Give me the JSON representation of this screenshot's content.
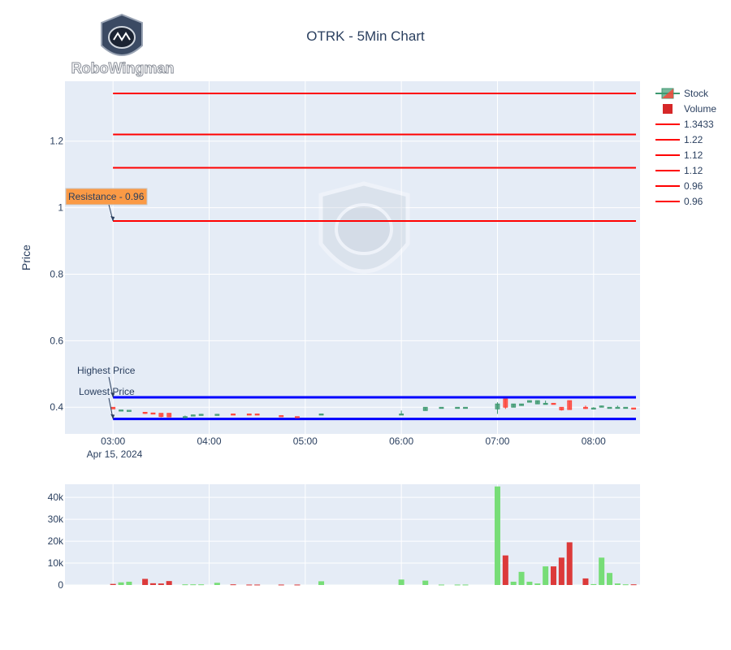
{
  "brand": {
    "logo_text": "RoboWingman"
  },
  "chart_data": {
    "type": "candlestick",
    "title": "OTRK - 5Min Chart",
    "price_axis": {
      "label": "Price",
      "ylim": [
        0.32,
        1.38
      ],
      "ticks": [
        0.4,
        0.6,
        0.8,
        1,
        1.2
      ],
      "tick_labels": [
        "0.4",
        "0.6",
        "0.8",
        "1",
        "1.2"
      ],
      "grid": true
    },
    "time_axis": {
      "start": "2024-04-15 02:30",
      "end": "2024-04-15 08:29",
      "ticks": [
        "03:00",
        "04:00",
        "05:00",
        "06:00",
        "07:00",
        "08:00"
      ],
      "tick_labels": [
        "03:00",
        "04:00",
        "05:00",
        "06:00",
        "07:00",
        "08:00"
      ],
      "date_label": "Apr 15, 2024"
    },
    "volume_axis": {
      "ylim": [
        0,
        46000
      ],
      "ticks": [
        0,
        10000,
        20000,
        30000,
        40000
      ],
      "tick_labels": [
        "0",
        "10k",
        "20k",
        "30k",
        "40k"
      ]
    },
    "horizontal_lines": [
      {
        "name": "1.3433",
        "value": 1.3433,
        "color": "#ff0000"
      },
      {
        "name": "1.22",
        "value": 1.22,
        "color": "#ff0000"
      },
      {
        "name": "1.12",
        "value": 1.12,
        "color": "#ff0000"
      },
      {
        "name": "1.12",
        "value": 1.12,
        "color": "#ff0000"
      },
      {
        "name": "0.96",
        "value": 0.96,
        "color": "#ff0000"
      },
      {
        "name": "0.96",
        "value": 0.96,
        "color": "#ff0000"
      }
    ],
    "level_lines": [
      {
        "value": 0.43,
        "color": "#0000ff"
      },
      {
        "value": 0.365,
        "color": "#0000ff"
      }
    ],
    "annotations": [
      {
        "text": "Resistance - 0.96",
        "time": "03:00",
        "value": 0.96,
        "boxed": true
      },
      {
        "text": "Highest Price",
        "time": "03:00",
        "value": 0.43
      },
      {
        "text": "Lowest Price",
        "time": "03:00",
        "value": 0.365
      }
    ],
    "legend": [
      {
        "name": "Stock",
        "kind": "candle"
      },
      {
        "name": "Volume",
        "kind": "bar",
        "color": "#d62728"
      },
      {
        "name": "1.3433",
        "kind": "line",
        "color": "#ff0000"
      },
      {
        "name": "1.22",
        "kind": "line",
        "color": "#ff0000"
      },
      {
        "name": "1.12",
        "kind": "line",
        "color": "#ff0000"
      },
      {
        "name": "1.12",
        "kind": "line",
        "color": "#ff0000"
      },
      {
        "name": "0.96",
        "kind": "line",
        "color": "#ff0000"
      },
      {
        "name": "0.96",
        "kind": "line",
        "color": "#ff0000"
      }
    ],
    "legend_position": "right",
    "colors": {
      "up": "#3d9970",
      "down": "#ff4136",
      "vol_up": "#77dd77",
      "vol_down": "#dc3a3a",
      "panel_bg": "#e5ecf6"
    },
    "candles": [
      {
        "t": "03:00",
        "o": 0.4,
        "h": 0.4,
        "l": 0.395,
        "c": 0.395,
        "v": 500
      },
      {
        "t": "03:05",
        "o": 0.39,
        "h": 0.39,
        "l": 0.39,
        "c": 0.392,
        "v": 1200
      },
      {
        "t": "03:10",
        "o": 0.39,
        "h": 0.39,
        "l": 0.39,
        "c": 0.391,
        "v": 1500
      },
      {
        "t": "03:20",
        "o": 0.385,
        "h": 0.385,
        "l": 0.38,
        "c": 0.382,
        "v": 2800
      },
      {
        "t": "03:25",
        "o": 0.383,
        "h": 0.383,
        "l": 0.382,
        "c": 0.381,
        "v": 800
      },
      {
        "t": "03:30",
        "o": 0.382,
        "h": 0.382,
        "l": 0.37,
        "c": 0.372,
        "v": 700
      },
      {
        "t": "03:35",
        "o": 0.382,
        "h": 0.382,
        "l": 0.37,
        "c": 0.371,
        "v": 1800
      },
      {
        "t": "03:45",
        "o": 0.37,
        "h": 0.375,
        "l": 0.37,
        "c": 0.372,
        "v": 300
      },
      {
        "t": "03:50",
        "o": 0.375,
        "h": 0.378,
        "l": 0.375,
        "c": 0.377,
        "v": 300
      },
      {
        "t": "03:55",
        "o": 0.377,
        "h": 0.38,
        "l": 0.377,
        "c": 0.379,
        "v": 300
      },
      {
        "t": "04:05",
        "o": 0.378,
        "h": 0.38,
        "l": 0.378,
        "c": 0.379,
        "v": 1000
      },
      {
        "t": "04:15",
        "o": 0.38,
        "h": 0.38,
        "l": 0.379,
        "c": 0.379,
        "v": 300
      },
      {
        "t": "04:25",
        "o": 0.38,
        "h": 0.38,
        "l": 0.379,
        "c": 0.379,
        "v": 200
      },
      {
        "t": "04:30",
        "o": 0.38,
        "h": 0.38,
        "l": 0.379,
        "c": 0.379,
        "v": 200
      },
      {
        "t": "04:45",
        "o": 0.375,
        "h": 0.375,
        "l": 0.374,
        "c": 0.374,
        "v": 200
      },
      {
        "t": "04:55",
        "o": 0.372,
        "h": 0.372,
        "l": 0.371,
        "c": 0.37,
        "v": 200
      },
      {
        "t": "05:10",
        "o": 0.379,
        "h": 0.38,
        "l": 0.379,
        "c": 0.38,
        "v": 1700
      },
      {
        "t": "06:00",
        "o": 0.378,
        "h": 0.39,
        "l": 0.378,
        "c": 0.38,
        "v": 2500
      },
      {
        "t": "06:15",
        "o": 0.39,
        "h": 0.4,
        "l": 0.39,
        "c": 0.4,
        "v": 2000
      },
      {
        "t": "06:25",
        "o": 0.4,
        "h": 0.4,
        "l": 0.4,
        "c": 0.4,
        "v": 200
      },
      {
        "t": "06:35",
        "o": 0.4,
        "h": 0.4,
        "l": 0.4,
        "c": 0.4,
        "v": 200
      },
      {
        "t": "06:40",
        "o": 0.4,
        "h": 0.4,
        "l": 0.4,
        "c": 0.4,
        "v": 200
      },
      {
        "t": "07:00",
        "o": 0.395,
        "h": 0.415,
        "l": 0.38,
        "c": 0.41,
        "v": 45000
      },
      {
        "t": "07:05",
        "o": 0.425,
        "h": 0.425,
        "l": 0.395,
        "c": 0.4,
        "v": 13500
      },
      {
        "t": "07:10",
        "o": 0.4,
        "h": 0.41,
        "l": 0.4,
        "c": 0.41,
        "v": 1500
      },
      {
        "t": "07:15",
        "o": 0.405,
        "h": 0.41,
        "l": 0.405,
        "c": 0.41,
        "v": 6000
      },
      {
        "t": "07:20",
        "o": 0.415,
        "h": 0.42,
        "l": 0.415,
        "c": 0.42,
        "v": 1500
      },
      {
        "t": "07:25",
        "o": 0.41,
        "h": 0.42,
        "l": 0.41,
        "c": 0.42,
        "v": 700
      },
      {
        "t": "07:30",
        "o": 0.41,
        "h": 0.42,
        "l": 0.41,
        "c": 0.412,
        "v": 8500
      },
      {
        "t": "07:35",
        "o": 0.412,
        "h": 0.412,
        "l": 0.41,
        "c": 0.41,
        "v": 8500
      },
      {
        "t": "07:40",
        "o": 0.4,
        "h": 0.4,
        "l": 0.39,
        "c": 0.392,
        "v": 12500
      },
      {
        "t": "07:45",
        "o": 0.42,
        "h": 0.42,
        "l": 0.393,
        "c": 0.393,
        "v": 19500
      },
      {
        "t": "07:55",
        "o": 0.4,
        "h": 0.405,
        "l": 0.395,
        "c": 0.396,
        "v": 3000
      },
      {
        "t": "08:00",
        "o": 0.397,
        "h": 0.4,
        "l": 0.397,
        "c": 0.398,
        "v": 400
      },
      {
        "t": "08:05",
        "o": 0.4,
        "h": 0.405,
        "l": 0.4,
        "c": 0.404,
        "v": 12500
      },
      {
        "t": "08:10",
        "o": 0.4,
        "h": 0.4,
        "l": 0.4,
        "c": 0.4,
        "v": 5500
      },
      {
        "t": "08:15",
        "o": 0.4,
        "h": 0.405,
        "l": 0.4,
        "c": 0.4,
        "v": 700
      },
      {
        "t": "08:20",
        "o": 0.4,
        "h": 0.4,
        "l": 0.4,
        "c": 0.4,
        "v": 300
      },
      {
        "t": "08:25",
        "o": 0.398,
        "h": 0.398,
        "l": 0.397,
        "c": 0.397,
        "v": 300
      }
    ]
  }
}
